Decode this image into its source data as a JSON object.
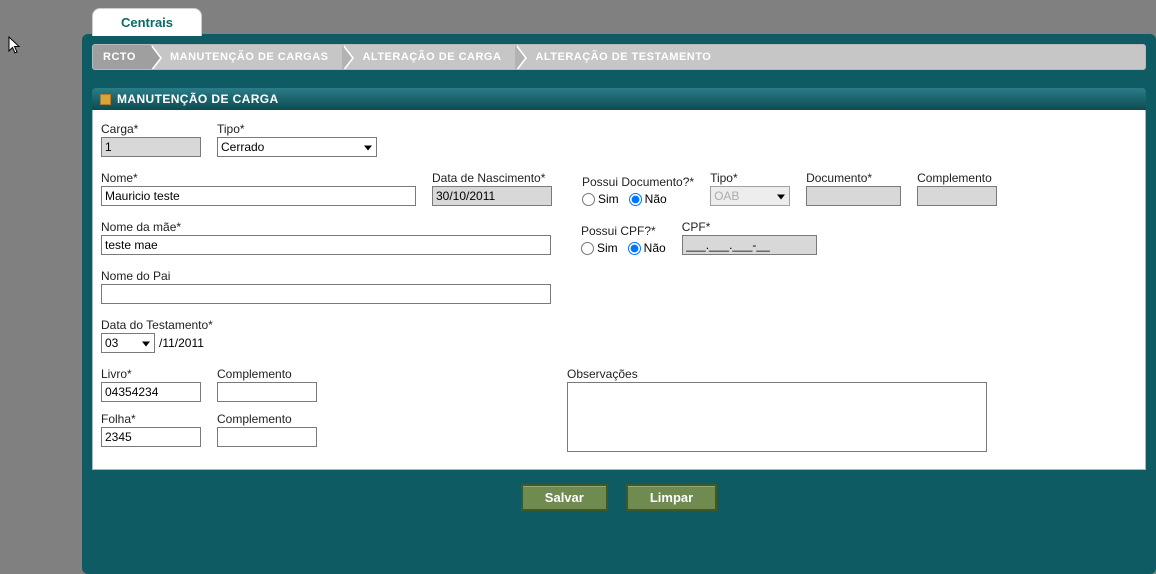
{
  "tab": {
    "label": "Centrais"
  },
  "breadcrumb": [
    "RCTO",
    "MANUTENÇÃO DE CARGAS",
    "ALTERAÇÃO DE CARGA",
    "ALTERAÇÃO DE TESTAMENTO"
  ],
  "section": {
    "title": "MANUTENÇÃO DE CARGA"
  },
  "labels": {
    "carga": "Carga*",
    "tipo": "Tipo*",
    "nome": "Nome*",
    "data_nasc": "Data de Nascimento*",
    "possui_doc": "Possui Documento?*",
    "doc_tipo": "Tipo*",
    "documento": "Documento*",
    "complemento": "Complemento",
    "nome_mae": "Nome da mãe*",
    "possui_cpf": "Possui CPF?*",
    "cpf": "CPF*",
    "nome_pai": "Nome do Pai",
    "data_testamento": "Data do Testamento*",
    "livro": "Livro*",
    "folha": "Folha*",
    "observacoes": "Observações",
    "sim": "Sim",
    "nao": "Não"
  },
  "values": {
    "carga": "1",
    "tipo": "Cerrado",
    "nome": "Mauricio teste",
    "data_nasc": "30/10/2011",
    "doc_tipo": "OAB",
    "documento": "",
    "doc_compl": "",
    "nome_mae": "teste mae",
    "cpf": "___.___.___-__",
    "nome_pai": "",
    "testamento_dia": "03",
    "testamento_resto": "/11/2011",
    "livro": "04354234",
    "livro_compl": "",
    "folha": "2345",
    "folha_compl": "",
    "observacoes": ""
  },
  "radios": {
    "possui_doc": "nao",
    "possui_cpf": "nao"
  },
  "buttons": {
    "salvar": "Salvar",
    "limpar": "Limpar"
  }
}
